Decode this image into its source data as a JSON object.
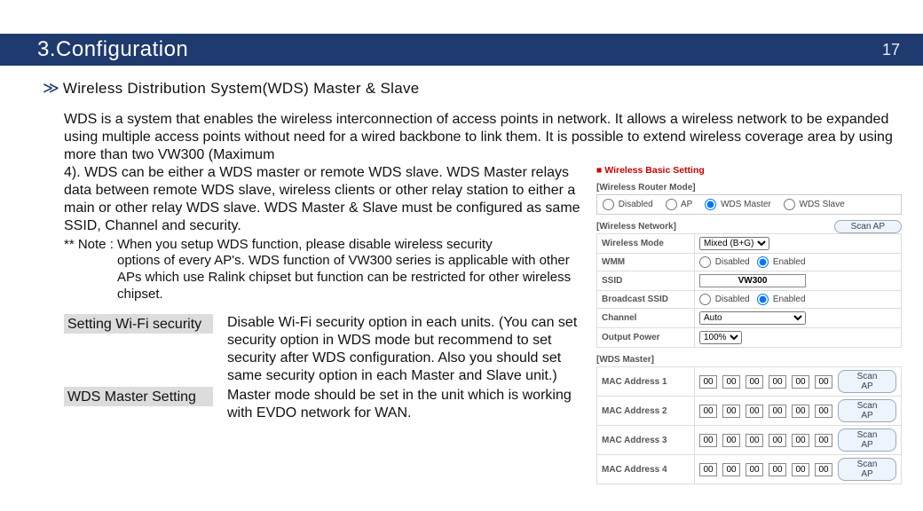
{
  "header": {
    "title": "3.Configuration",
    "page": "17"
  },
  "section": {
    "chevrons": "≫",
    "title": "Wireless Distribution System(WDS) Master & Slave"
  },
  "para_top": "WDS is a system that enables the wireless interconnection of access points in network. It allows a wireless network to be expanded using multiple access points without need for a wired backbone to link them. It is possible to extend wireless coverage area by using more than two VW300 (Maximum",
  "para_left": "4). WDS can be either a WDS master or remote WDS slave. WDS Master relays data between remote WDS slave, wireless clients or other relay station to either a main or other relay WDS slave. WDS Master & Slave must be configured as same SSID, Channel and security.",
  "note_lead": "** Note : When you setup WDS function, please disable wireless security",
  "note_body": "options of every AP's. WDS function of VW300 series is applicable with other APs which use Ralink chipset but function can be restricted for other wireless chipset.",
  "def1_label": "Setting Wi-Fi security",
  "def1_text": "Disable Wi-Fi security option in each units. (You can set security option in WDS mode but recommend to set security after WDS configuration. Also you should set same security option in each Master and Slave unit.)",
  "def2_label": "WDS Master Setting",
  "def2_text": "Master mode should be set in the unit which is working with EVDO network for WAN.",
  "embed": {
    "title_icon": "■",
    "title": "Wireless Basic Setting",
    "router_caption": "[Wireless Router Mode]",
    "router_opts": [
      "Disabled",
      "AP",
      "WDS Master",
      "WDS Slave"
    ],
    "router_selected": "WDS Master",
    "network_caption": "[Wireless Network]",
    "scan_label": "Scan AP",
    "rows": {
      "mode_label": "Wireless Mode",
      "mode_value": "Mixed (B+G)",
      "wmm_label": "WMM",
      "wmm_value": "Enabled",
      "ssid_label": "SSID",
      "ssid_value": "VW300",
      "bssid_label": "Broadcast SSID",
      "bssid_value": "Enabled",
      "channel_label": "Channel",
      "channel_value": "Auto",
      "power_label": "Output Power",
      "power_value": "100%"
    },
    "opt_disabled": "Disabled",
    "opt_enabled": "Enabled",
    "wds_caption": "[WDS Master]",
    "mac_labels": [
      "MAC Address 1",
      "MAC Address 2",
      "MAC Address 3",
      "MAC Address 4"
    ],
    "mac_octet": "00"
  }
}
